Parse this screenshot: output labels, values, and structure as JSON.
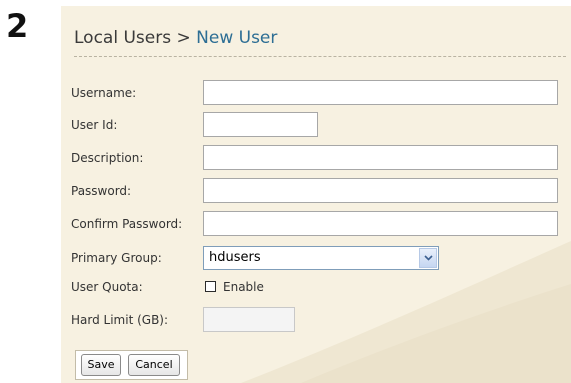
{
  "step_number": "2",
  "header": {
    "breadcrumb_root": "Local Users",
    "breadcrumb_separator": ">",
    "breadcrumb_current": "New User"
  },
  "form": {
    "username_label": "Username:",
    "username_value": "",
    "userid_label": "User Id:",
    "userid_value": "",
    "description_label": "Description:",
    "description_value": "",
    "password_label": "Password:",
    "password_value": "",
    "confirm_password_label": "Confirm Password:",
    "confirm_password_value": "",
    "primary_group_label": "Primary Group:",
    "primary_group_value": "hdusers",
    "user_quota_label": "User Quota:",
    "user_quota_enable_label": "Enable",
    "user_quota_enabled": false,
    "hard_limit_label": "Hard Limit (GB):",
    "hard_limit_value": ""
  },
  "buttons": {
    "save_label": "Save",
    "cancel_label": "Cancel"
  },
  "colors": {
    "panel_background": "#f7f1e1",
    "breadcrumb_current": "#2d6e94"
  }
}
